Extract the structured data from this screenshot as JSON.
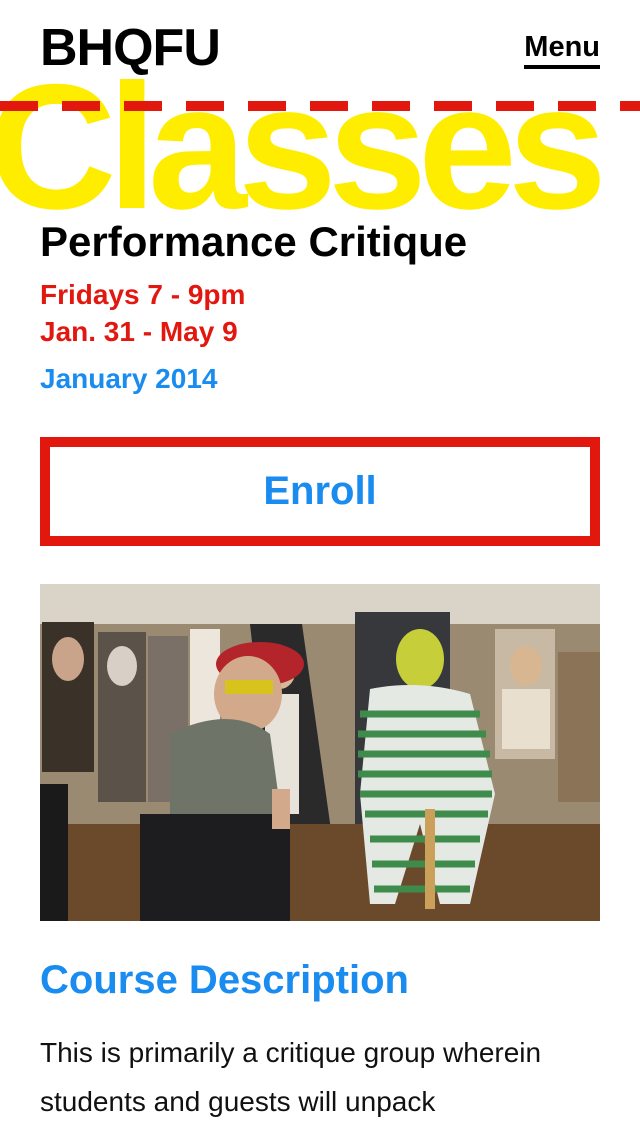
{
  "header": {
    "logo": "BHQFU",
    "menu_label": "Menu"
  },
  "hero": {
    "text": "Classes"
  },
  "course": {
    "title": "Performance Critique",
    "schedule_days": "Fridays 7 - 9pm",
    "schedule_dates": "Jan. 31 - May 9",
    "term": "January 2014",
    "enroll_label": "Enroll"
  },
  "description": {
    "heading": "Course Description",
    "text": "This is primarily a critique group wherein students and guests will unpack"
  },
  "colors": {
    "accent_red": "#e2170e",
    "accent_blue": "#1a8cf0",
    "hero_yellow": "#ffed00"
  }
}
